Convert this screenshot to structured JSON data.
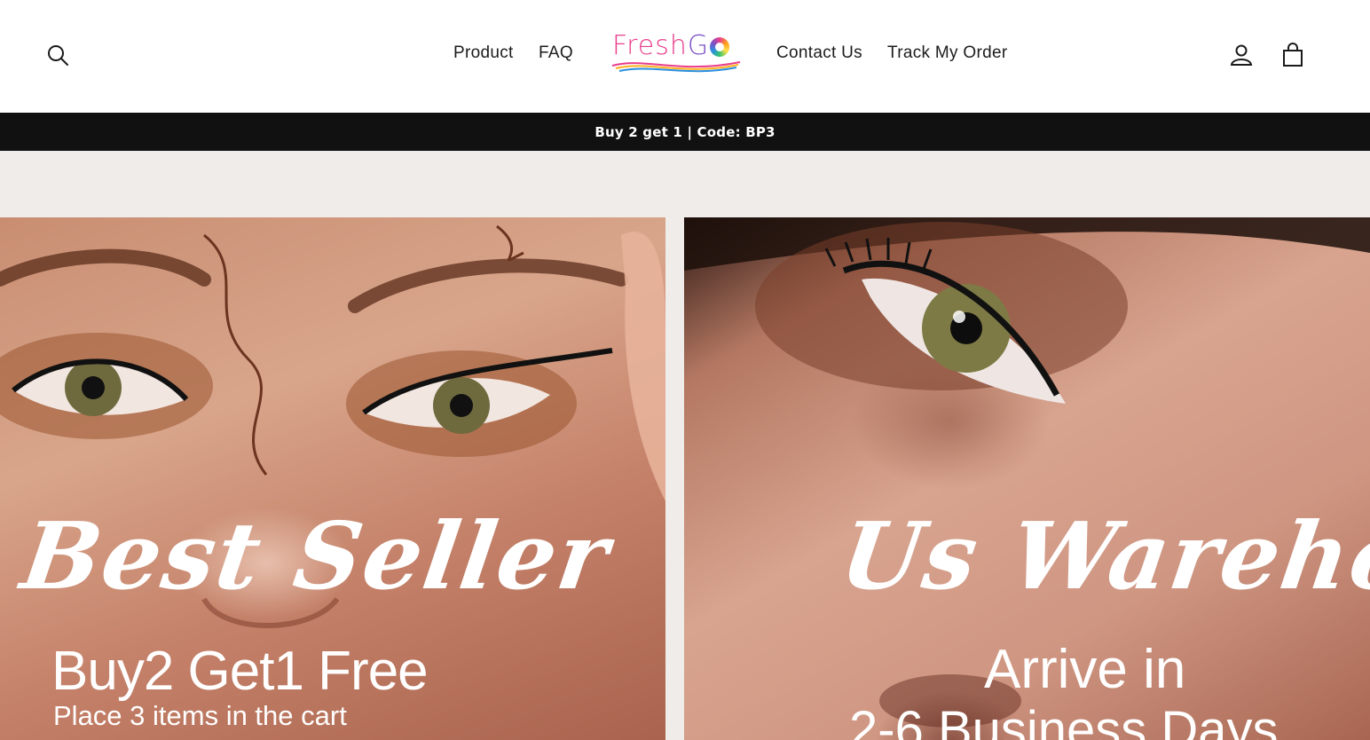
{
  "header": {
    "nav": {
      "product": "Product",
      "faq": "FAQ",
      "contact": "Contact Us",
      "track": "Track My Order"
    },
    "logo": {
      "part1": "Fresh",
      "part2": "G",
      "part3": "o"
    },
    "icons": [
      "search-icon",
      "user-icon",
      "cart-icon"
    ]
  },
  "announcement": {
    "text": "Buy 2 get 1 | Code: BP3"
  },
  "promos": {
    "left": {
      "title": "Best Seller",
      "line1": "Buy2 Get1 Free",
      "line2": "Place 3 items in the cart"
    },
    "right": {
      "title": "Us Warehouse",
      "line1": "Arrive in",
      "line2": "2-6 Business Days"
    }
  },
  "colors": {
    "announcement_bg": "#111111",
    "band_bg": "#f0ecea",
    "logo_pink": "#e83e8c",
    "logo_purple": "#7b52c7",
    "logo_blue": "#2a8fe0"
  }
}
